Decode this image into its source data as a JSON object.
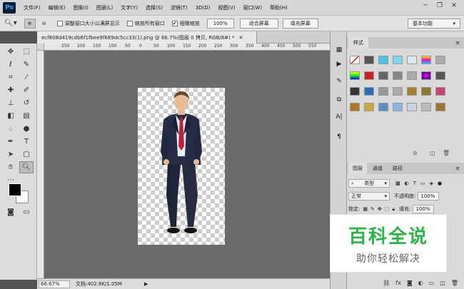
{
  "app": {
    "logo": "Ps"
  },
  "menu": [
    "文件(F)",
    "编辑(E)",
    "图像(I)",
    "图层(L)",
    "文字(Y)",
    "选择(S)",
    "滤镜(T)",
    "3D(D)",
    "视图(V)",
    "窗口(W)",
    "帮助(H)"
  ],
  "window_controls": {
    "minimize": "─",
    "restore": "❐",
    "close": "✕"
  },
  "options": {
    "resize_windows": "调整窗口大小以满屏显示",
    "zoom_all": "缩放所有窗口",
    "scrubby_zoom": "细微缩放",
    "zoom_value": "100%",
    "fit_screen": "适合屏幕",
    "fill_screen": "填充屏幕",
    "workspace": "基本功能"
  },
  "document_tab": {
    "title": "ecf808d419cdb6f1fbee9f689dc5cc33(1).png @ 66.7%(图层 0 拷贝, RGB/8#) *",
    "close": "✕"
  },
  "ruler": {
    "ticks": [
      "250",
      "200",
      "150",
      "100",
      "50",
      "0",
      "50",
      "100",
      "150",
      "200",
      "250",
      "300",
      "350",
      "400",
      "450",
      "500",
      "550"
    ]
  },
  "status": {
    "zoom": "66.67%",
    "doc_info": "文档:402.8K/1.05M"
  },
  "styles_panel": {
    "tab": "样式"
  },
  "layers_panel": {
    "tabs": [
      "图层",
      "通道",
      "路径"
    ],
    "filter_kind": "类型",
    "blend_mode": "正常",
    "opacity_label": "不透明度:",
    "opacity_value": "100%",
    "lock_label": "锁定:",
    "fill_label": "填充:",
    "fill_value": "100%"
  },
  "watermark": {
    "title": "百科全说",
    "subtitle": "助你轻松解决"
  },
  "colors": {
    "foreground": "#000000",
    "background": "#ffffff",
    "brand_green": "#2db34a"
  }
}
